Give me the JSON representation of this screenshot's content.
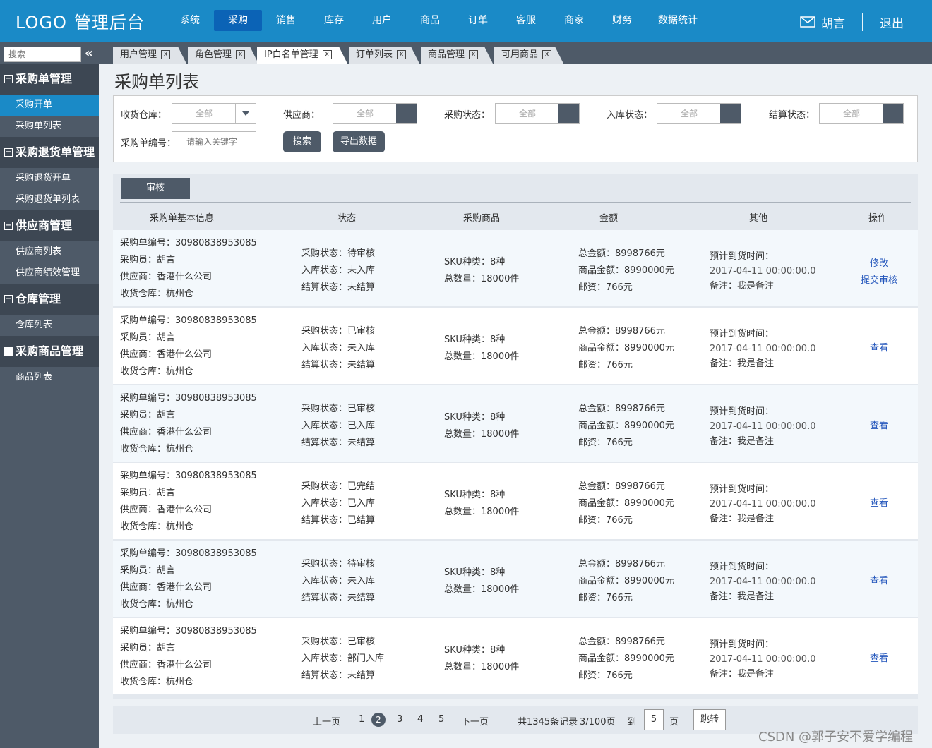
{
  "header": {
    "logo_text": "LOGO",
    "app_title": "管理后台",
    "nav": [
      "系统",
      "采购",
      "销售",
      "库存",
      "用户",
      "商品",
      "订单",
      "客服",
      "商家",
      "财务",
      "数据统计"
    ],
    "active_nav": "采购",
    "user_name": "胡言",
    "logout_label": "退出",
    "accent_color": "#1a8ac7"
  },
  "sidebar": {
    "search_placeholder": "搜索",
    "collapse_icon": "«",
    "groups": [
      {
        "title": "采购单管理",
        "items": [
          "采购开单",
          "采购单列表"
        ]
      },
      {
        "title": "采购退货单管理",
        "items": [
          "采购退货开单",
          "采购退货单列表"
        ]
      },
      {
        "title": "供应商管理",
        "items": [
          "供应商列表",
          "供应商绩效管理"
        ]
      },
      {
        "title": "仓库管理",
        "items": [
          "仓库列表"
        ]
      },
      {
        "title": "采购商品管理",
        "items": [
          "商品列表"
        ]
      }
    ],
    "active_item": "采购开单"
  },
  "tabs": [
    {
      "label": "用户管理",
      "close": "X"
    },
    {
      "label": "角色管理",
      "close": "X"
    },
    {
      "label": "IP白名单管理",
      "close": "X"
    },
    {
      "label": "订单列表",
      "close": "X"
    },
    {
      "label": "商品管理",
      "close": "X"
    },
    {
      "label": "可用商品",
      "close": "X"
    }
  ],
  "page_title": "采购单列表",
  "filters": {
    "warehouse_label": "收货仓库：",
    "supplier_label": "供应商：",
    "purchase_status_label": "采购状态：",
    "stock_status_label": "入库状态：",
    "settle_status_label": "结算状态：",
    "all_value": "全部",
    "order_no_label": "采购单编号：",
    "order_no_placeholder": "请输入关键字",
    "search_button": "搜索",
    "export_button": "导出数据"
  },
  "table": {
    "audit_button": "审核",
    "headers": [
      "采购单基本信息",
      "状态",
      "采购商品",
      "金额",
      "其他",
      "操作"
    ],
    "rows": [
      {
        "basic": [
          "采购单编号：30980838953085",
          "采购员：胡言",
          "供应商：香港什么公司",
          "收货仓库：杭州仓"
        ],
        "status": [
          "采购状态：待审核",
          "入库状态：未入库",
          "结算状态：未结算"
        ],
        "goods": [
          "SKU种类：8种",
          "总数量：18000件"
        ],
        "amount": [
          "总金额：8998766元",
          "商品金额：8990000元",
          "邮资：766元"
        ],
        "other": [
          "预计到货时间：",
          "2017-04-11 00:00:00.0",
          "备注：我是备注"
        ],
        "ops": [
          "修改",
          "提交审核"
        ]
      },
      {
        "basic": [
          "采购单编号：30980838953085",
          "采购员：胡言",
          "供应商：香港什么公司",
          "收货仓库：杭州仓"
        ],
        "status": [
          "采购状态：已审核",
          "入库状态：未入库",
          "结算状态：未结算"
        ],
        "goods": [
          "SKU种类：8种",
          "总数量：18000件"
        ],
        "amount": [
          "总金额：8998766元",
          "商品金额：8990000元",
          "邮资：766元"
        ],
        "other": [
          "预计到货时间：",
          "2017-04-11 00:00:00.0",
          "备注：我是备注"
        ],
        "ops": [
          "查看"
        ]
      },
      {
        "basic": [
          "采购单编号：30980838953085",
          "采购员：胡言",
          "供应商：香港什么公司",
          "收货仓库：杭州仓"
        ],
        "status": [
          "采购状态：已审核",
          "入库状态：已入库",
          "结算状态：未结算"
        ],
        "goods": [
          "SKU种类：8种",
          "总数量：18000件"
        ],
        "amount": [
          "总金额：8998766元",
          "商品金额：8990000元",
          "邮资：766元"
        ],
        "other": [
          "预计到货时间：",
          "2017-04-11 00:00:00.0",
          "备注：我是备注"
        ],
        "ops": [
          "查看"
        ]
      },
      {
        "basic": [
          "采购单编号：30980838953085",
          "采购员：胡言",
          "供应商：香港什么公司",
          "收货仓库：杭州仓"
        ],
        "status": [
          "采购状态：已完结",
          "入库状态：已入库",
          "结算状态：已结算"
        ],
        "goods": [
          "SKU种类：8种",
          "总数量：18000件"
        ],
        "amount": [
          "总金额：8998766元",
          "商品金额：8990000元",
          "邮资：766元"
        ],
        "other": [
          "预计到货时间：",
          "2017-04-11 00:00:00.0",
          "备注：我是备注"
        ],
        "ops": [
          "查看"
        ]
      },
      {
        "basic": [
          "采购单编号：30980838953085",
          "采购员：胡言",
          "供应商：香港什么公司",
          "收货仓库：杭州仓"
        ],
        "status": [
          "采购状态：待审核",
          "入库状态：未入库",
          "结算状态：未结算"
        ],
        "goods": [
          "SKU种类：8种",
          "总数量：18000件"
        ],
        "amount": [
          "总金额：8998766元",
          "商品金额：8990000元",
          "邮资：766元"
        ],
        "other": [
          "预计到货时间：",
          "2017-04-11 00:00:00.0",
          "备注：我是备注"
        ],
        "ops": [
          "查看"
        ]
      },
      {
        "basic": [
          "采购单编号：30980838953085",
          "采购员：胡言",
          "供应商：香港什么公司",
          "收货仓库：杭州仓"
        ],
        "status": [
          "采购状态：已审核",
          "入库状态：部门入库",
          "结算状态：未结算"
        ],
        "goods": [
          "SKU种类：8种",
          "总数量：18000件"
        ],
        "amount": [
          "总金额：8998766元",
          "商品金额：8990000元",
          "邮资：766元"
        ],
        "other": [
          "预计到货时间：",
          "2017-04-11 00:00:00.0",
          "备注：我是备注"
        ],
        "ops": [
          "查看"
        ]
      }
    ]
  },
  "pagination": {
    "prev": "上一页",
    "pages": [
      "1",
      "2",
      "3",
      "4",
      "5"
    ],
    "current": "2",
    "next": "下一页",
    "summary": "共1345条记录",
    "page_info": "3/100页",
    "goto_label": "到",
    "goto_value": "5",
    "page_unit": "页",
    "jump_button": "跳转"
  },
  "watermark": "CSDN @郭子安不爱学编程"
}
